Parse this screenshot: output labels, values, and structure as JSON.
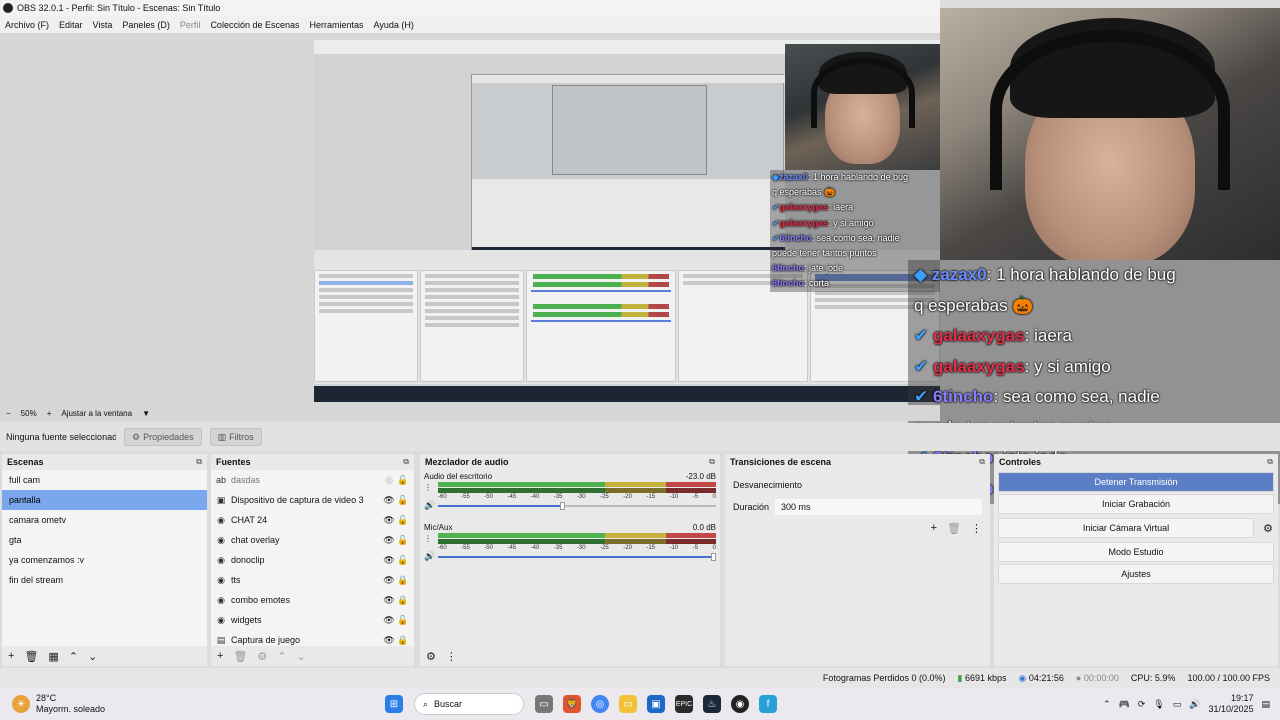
{
  "window": {
    "title": "OBS 32.0.1 - Perfil: Sin Título - Escenas: Sin Título"
  },
  "menu": [
    {
      "label": "Archivo (F)",
      "disabled": false
    },
    {
      "label": "Editar",
      "disabled": false
    },
    {
      "label": "Vista",
      "disabled": false
    },
    {
      "label": "Paneles (D)",
      "disabled": false
    },
    {
      "label": "Perfil",
      "disabled": true
    },
    {
      "label": "Colección de Escenas",
      "disabled": false
    },
    {
      "label": "Herramientas",
      "disabled": false
    },
    {
      "label": "Ayuda (H)",
      "disabled": false
    }
  ],
  "chat": [
    {
      "user": "zazax0",
      "msg": ": 1 hora hablando de bug",
      "cont": "q esperabas 🎃",
      "color": "blue"
    },
    {
      "user": "galaaxygas",
      "msg": ": iaera",
      "color": "red"
    },
    {
      "user": "galaaxygas",
      "msg": ": y si amigo",
      "color": "red"
    },
    {
      "user": "6tincho",
      "msg": ": sea como sea, nadie",
      "cont": "puede tener tantos puntos",
      "color": "purple"
    },
    {
      "user": "6tincho",
      "msg": ": jate jode",
      "color": "purple"
    },
    {
      "user": "6tincho",
      "msg": ": corta",
      "color": "purple"
    }
  ],
  "zoom": {
    "percent": "50%",
    "fit_label": "Ajustar a la ventana"
  },
  "source_toolbar": {
    "no_source": "Ninguna fuente seleccionada",
    "properties": "Propiedades",
    "filters": "Filtros"
  },
  "scenes": {
    "title": "Escenas",
    "items": [
      "full cam",
      "pantalla",
      "camara ometv",
      "gta",
      "ya comenzamos :v",
      "fin del stream"
    ],
    "selected": 1
  },
  "sources": {
    "title": "Fuentes",
    "items": [
      {
        "name": "dasdas",
        "icon": "text-icon",
        "visible": false,
        "locked": false
      },
      {
        "name": "Dispositivo de captura de video 3",
        "icon": "camera-icon",
        "visible": true,
        "locked": false
      },
      {
        "name": "CHAT 24",
        "icon": "browser-icon",
        "visible": true,
        "locked": false
      },
      {
        "name": "chat overlay",
        "icon": "browser-icon",
        "visible": true,
        "locked": false
      },
      {
        "name": "donoclip",
        "icon": "browser-icon",
        "visible": true,
        "locked": false
      },
      {
        "name": "tts",
        "icon": "browser-icon",
        "visible": true,
        "locked": true
      },
      {
        "name": "combo emotes",
        "icon": "browser-icon",
        "visible": true,
        "locked": true
      },
      {
        "name": "widgets",
        "icon": "browser-icon",
        "visible": true,
        "locked": false
      },
      {
        "name": "Captura de juego",
        "icon": "game-icon",
        "visible": true,
        "locked": true
      }
    ]
  },
  "mixer": {
    "title": "Mezclador de audio",
    "channels": [
      {
        "name": "Audio del escritorio",
        "db": "-23.0 dB",
        "level": 0.82,
        "volume": 0.45
      },
      {
        "name": "Mic/Aux",
        "db": "0.0 dB",
        "level": 0.9,
        "volume": 1.0
      }
    ],
    "scale": [
      "-60",
      "-55",
      "-50",
      "-45",
      "-40",
      "-35",
      "-30",
      "-25",
      "-20",
      "-15",
      "-10",
      "-5",
      "0"
    ]
  },
  "transitions": {
    "title": "Transiciones de escena",
    "type": "Desvanecimiento",
    "duration_label": "Duración",
    "duration": "300 ms"
  },
  "controls": {
    "title": "Controles",
    "buttons": [
      "Detener Transmisión",
      "Iniciar Grabación",
      "Iniciar Cámara Virtual",
      "Modo Estudio",
      "Ajustes"
    ]
  },
  "status": {
    "dropped": "Fotogramas Perdidos 0 (0.0%)",
    "kbps": "6691 kbps",
    "stream_time": "04:21:56",
    "rec_time": "00:00:00",
    "cpu": "CPU: 5.9%",
    "fps": "100.00 / 100.00 FPS"
  },
  "taskbar": {
    "weather_temp": "28°C",
    "weather_desc": "Mayorm. soleado",
    "search": "Buscar",
    "time": "19:17",
    "date": "31/10/2025"
  },
  "colors": {
    "selection": "#79a6ec",
    "stream_active": "#5c7ec5",
    "chat_blue": "#6a8cff",
    "chat_red": "#e0304a",
    "chat_purple": "#8a7cff"
  }
}
